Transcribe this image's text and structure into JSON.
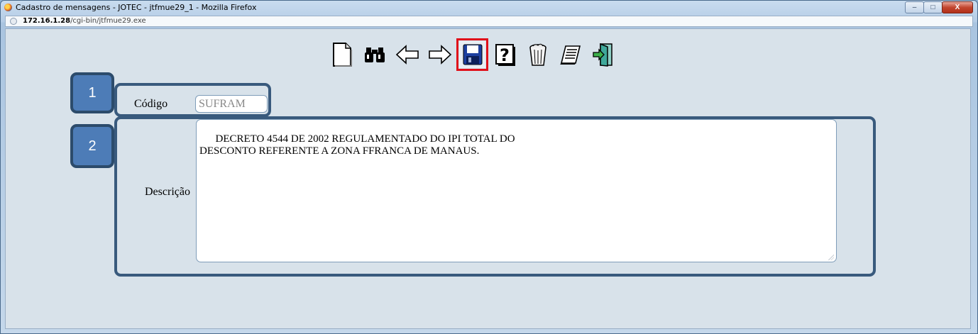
{
  "window": {
    "title": "Cadastro de mensagens - JOTEC - jtfmue29_1 - Mozilla Firefox",
    "buttons": [
      "–",
      "□",
      "X"
    ]
  },
  "urlbar": {
    "host": "172.16.1.28",
    "path": "/cgi-bin/jtfmue29.exe"
  },
  "toolbar": {
    "items": [
      {
        "name": "new-document",
        "icon": "blank-page-icon"
      },
      {
        "name": "search",
        "icon": "binoculars-icon"
      },
      {
        "name": "previous",
        "icon": "left-arrow-icon"
      },
      {
        "name": "next",
        "icon": "right-arrow-icon"
      },
      {
        "name": "save",
        "icon": "floppy-disk-icon",
        "selected": true
      },
      {
        "name": "help",
        "icon": "question-mark-icon"
      },
      {
        "name": "delete",
        "icon": "trash-can-icon"
      },
      {
        "name": "notes",
        "icon": "notepad-icon"
      },
      {
        "name": "exit",
        "icon": "exit-door-icon"
      }
    ]
  },
  "form": {
    "codigo_label": "Código",
    "codigo_value": "SUFRAM",
    "descricao_label": "Descrição",
    "descricao_value": "DECRETO 4544 DE 2002 REGULAMENTADO DO IPI TOTAL DO\nDESCONTO REFERENTE A ZONA FFRANCA DE MANAUS."
  },
  "annotations": {
    "step1": "1",
    "step2": "2"
  },
  "colors": {
    "highlight": "#e0101a",
    "annotation_border": "#395a7d",
    "badge_fill": "#4d7cb7"
  }
}
